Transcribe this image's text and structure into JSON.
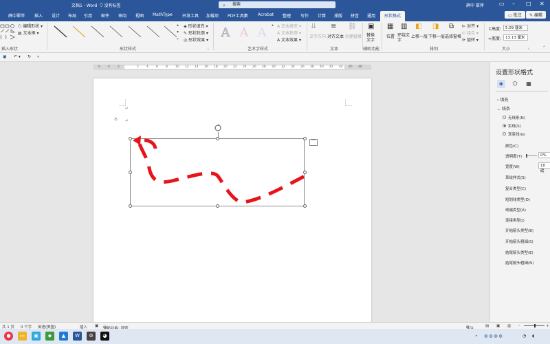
{
  "window": {
    "doc_title": "文档1 - Word",
    "label_status": "没有标签",
    "search_placeholder": "搜索",
    "user": "薛中 翠萍"
  },
  "tabs": [
    {
      "label": "薛中翠萍"
    },
    {
      "label": "插入"
    },
    {
      "label": "设计"
    },
    {
      "label": "布局"
    },
    {
      "label": "引用"
    },
    {
      "label": "邮件"
    },
    {
      "label": "审阅"
    },
    {
      "label": "视图"
    },
    {
      "label": "MathType"
    },
    {
      "label": "开发工具"
    },
    {
      "label": "加载项"
    },
    {
      "label": "PDF工具集"
    },
    {
      "label": "Acrobat"
    },
    {
      "label": "整理"
    },
    {
      "label": "写作"
    },
    {
      "label": "计算"
    },
    {
      "label": "排版"
    },
    {
      "label": "拼音"
    },
    {
      "label": "通用"
    },
    {
      "label": "形状格式"
    }
  ],
  "tab_buttons": {
    "comment": "批注",
    "edit": "编辑"
  },
  "ribbon": {
    "insert_shapes": {
      "edit_shape": "编辑形状",
      "text_box": "文本框",
      "label": "插入形状"
    },
    "shape_styles": {
      "fill": "形状填充",
      "outline": "形状轮廓",
      "effect": "形状效果",
      "label": "形状样式"
    },
    "wordart": {
      "text_fill": "文本填充",
      "text_outline": "文本轮廓",
      "text_effect": "文本效果",
      "label": "艺术字样式"
    },
    "text": {
      "direction": "文字方向",
      "align": "对齐文本",
      "link": "创建链接",
      "label": "文本"
    },
    "accessibility": {
      "alt_text": "替换文字",
      "label": "辅助功能"
    },
    "arrange": {
      "position": "位置",
      "wrap": "环绕文字",
      "forward": "上移一层",
      "backward": "下移一层",
      "pane": "选择窗格",
      "align": "对齐",
      "group": "组合",
      "rotate": "旋转",
      "label": "排列"
    },
    "size": {
      "height_label": "高度:",
      "height": "5.09 厘米",
      "width_label": "宽度:",
      "width": "13.13 厘米",
      "label": "大小"
    }
  },
  "ruler": {
    "ticks": [
      "6",
      "4",
      "2",
      "",
      "2",
      "4",
      "6",
      "8",
      "10",
      "12",
      "14",
      "16",
      "18",
      "20",
      "22",
      "24",
      "26",
      "28",
      "30",
      "32",
      "34",
      "36",
      "38",
      "40",
      "42",
      "44",
      "46",
      "48"
    ]
  },
  "document": {
    "para_mark": "↵"
  },
  "format_pane": {
    "title": "设置形状格式",
    "fill": "填充",
    "line": "线条",
    "no_line": "无线条(N)",
    "solid_line": "实线(S)",
    "gradient_line": "渐变线(G)",
    "color": "颜色(C)",
    "transparency": "透明度(T)",
    "transparency_value": "0%",
    "width": "宽度(W)",
    "width_value": "10 磅",
    "sketch": "草绘样式(S)",
    "compound": "复合类型(C)",
    "dash": "短划线类型(D)",
    "cap": "线端类型(A)",
    "join": "连接类型(J)",
    "begin_arrow_type": "开始箭头类型(B)",
    "begin_arrow_size": "开始箭头粗细(S)",
    "end_arrow_type": "结尾箭头类型(E)",
    "end_arrow_size": "结尾箭头粗细(N)"
  },
  "status": {
    "page": "共 1 页",
    "words": "0 个字",
    "lang": "英语(美国)",
    "mode": "插入",
    "accessibility": "辅助功能: 调查",
    "focus": "专注"
  },
  "colors": {
    "accent": "#2b579a",
    "shape_stroke": "#e8141b"
  }
}
